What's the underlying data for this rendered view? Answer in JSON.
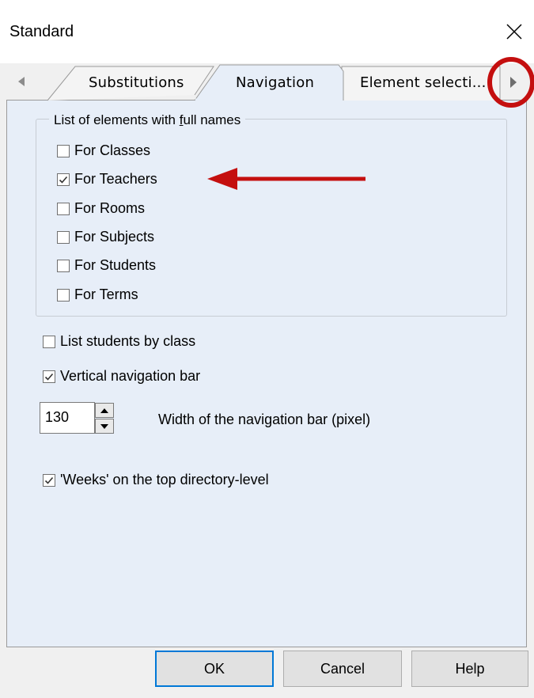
{
  "window": {
    "title": "Standard"
  },
  "tabs": [
    {
      "label": "Substitutions",
      "active": false
    },
    {
      "label": "Navigation",
      "active": true
    },
    {
      "label": "Element selecti...",
      "active": false
    }
  ],
  "group": {
    "legend_prefix": "List of elements with ",
    "legend_underlined": "f",
    "legend_suffix": "ull names",
    "options": [
      {
        "label": "For Classes",
        "checked": false
      },
      {
        "label": "For Teachers",
        "checked": true
      },
      {
        "label": "For Rooms",
        "checked": false
      },
      {
        "label": "For Subjects",
        "checked": false
      },
      {
        "label": "For Students",
        "checked": false
      },
      {
        "label": "For Terms",
        "checked": false
      }
    ]
  },
  "options": {
    "list_by_class": {
      "label": "List students by class",
      "checked": false
    },
    "vertical_nav": {
      "label": "Vertical navigation bar",
      "checked": true
    },
    "weeks_top": {
      "label": "'Weeks' on the top directory-level",
      "checked": true
    }
  },
  "nav_width": {
    "value": "130",
    "caption": "Width of the navigation bar (pixel)"
  },
  "buttons": {
    "ok": "OK",
    "cancel": "Cancel",
    "help": "Help"
  },
  "colors": {
    "annotation": "#c40f0f",
    "page_bg": "#e7eef8",
    "default_button_border": "#0078d7"
  }
}
